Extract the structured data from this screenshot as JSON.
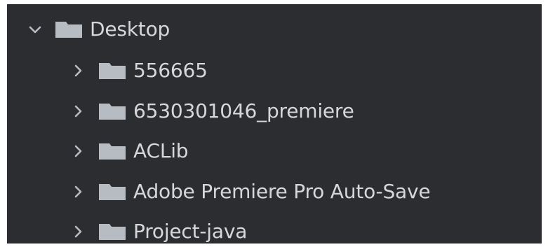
{
  "tree": {
    "root": {
      "label": "Desktop",
      "icon": "folder-icon",
      "expanded": true
    },
    "children": [
      {
        "label": "556665",
        "icon": "folder-icon",
        "expanded": false
      },
      {
        "label": "6530301046_premiere",
        "icon": "folder-icon",
        "expanded": false
      },
      {
        "label": "ACLib",
        "icon": "folder-icon",
        "expanded": false
      },
      {
        "label": "Adobe Premiere Pro Auto-Save",
        "icon": "folder-icon",
        "expanded": false
      },
      {
        "label": "Project-java",
        "icon": "folder-icon",
        "expanded": false
      }
    ]
  },
  "colors": {
    "panel_background": "#2b2d30",
    "text": "#d5d7da",
    "icon": "#b7bcc2",
    "page_background": "#ffffff"
  }
}
